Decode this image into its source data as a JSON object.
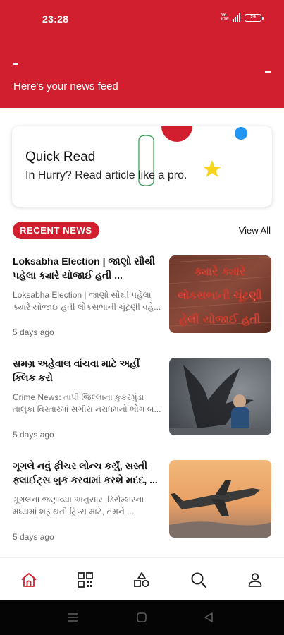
{
  "status_bar": {
    "time": "23:28",
    "network": "Vo LTE",
    "battery": "29"
  },
  "header": {
    "subtitle": "Here's your news feed"
  },
  "quick_read": {
    "title": "Quick Read",
    "subtitle": "In Hurry? Read article like a pro."
  },
  "recent": {
    "pill_label": "RECENT NEWS",
    "view_all_label": "View All"
  },
  "news": [
    {
      "title": "Loksabha Election | જાણો સૌથી પહેલા ક્યારે યોજાઈ હતી ...",
      "description": "Loksabha Election | જાણો સૌથી પહેલા ક્યારે યોજાઈ હતી લોકસભાની ચૂંટણી વહે...",
      "time": "5 days ago",
      "thumb_text_line1": "ક્યારે ક્યારે",
      "thumb_text_line2": "લોકસભાની ચૂંટણી",
      "thumb_text_line3": "હેલી યોજાઈ હતી"
    },
    {
      "title": "સમગ્ર અહેવાલ વાંચવા માટે અહીં ક્લિક કરો",
      "description": "Crime News: તાપી જિલ્લાના કુકરમુંડા તાલુકા વિસ્તારમાં સગીરા નરાધમનો ભોગ બ...",
      "time": "5 days ago"
    },
    {
      "title": "ગૂગલે નવું ફીચર લોન્ચ કર્યું, સસ્તી ફ્લાઈટ્સ બુક કરવામાં કરશે મદદ, ...",
      "description": "ગૂગલના જણાવ્યા અનુસાર, ડિસેમ્બરના મધ્યમાં શરૂ થતી ટ્રિપ્સ માટે, તમને ...",
      "time": "5 days ago"
    }
  ],
  "bottom_nav": [
    {
      "icon": "home-icon",
      "active": true
    },
    {
      "icon": "categories-icon",
      "active": false
    },
    {
      "icon": "shapes-icon",
      "active": false
    },
    {
      "icon": "search-icon",
      "active": false
    },
    {
      "icon": "profile-icon",
      "active": false
    }
  ],
  "colors": {
    "brand_red": "#d11f2f",
    "accent_blue": "#2196f3",
    "accent_yellow": "#f7d51d",
    "accent_green": "#2e9e4f"
  }
}
